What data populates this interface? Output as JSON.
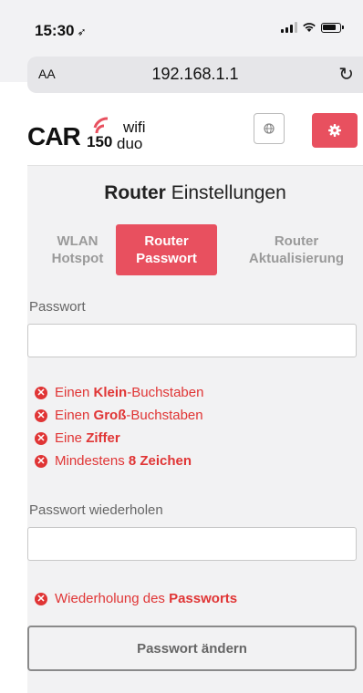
{
  "status_bar": {
    "time": "15:30",
    "location_glyph": "➶"
  },
  "browser": {
    "text_size_label": "AA",
    "url": "192.168.1.1",
    "reload_glyph": "↻"
  },
  "brand": {
    "car": "CAR",
    "model": "150",
    "wifi": "wifi",
    "duo": "duo",
    "accent": "#e8505f"
  },
  "page": {
    "title_bold": "Router",
    "title_rest": " Einstellungen"
  },
  "tabs": [
    {
      "line1": "WLAN",
      "line2": "Hotspot",
      "active": false
    },
    {
      "line1": "Router",
      "line2": "Passwort",
      "active": true
    },
    {
      "line1": "Router",
      "line2": "Aktualisierung",
      "active": false
    }
  ],
  "password": {
    "label": "Passwort",
    "value": ""
  },
  "requirements": [
    {
      "pre": "Einen ",
      "bold": "Klein",
      "post": "-Buchstaben"
    },
    {
      "pre": "Einen ",
      "bold": "Groß",
      "post": "-Buchstaben"
    },
    {
      "pre": "Eine ",
      "bold": "Ziffer",
      "post": ""
    },
    {
      "pre": "Mindestens ",
      "bold": "8 Zeichen",
      "post": ""
    }
  ],
  "repeat": {
    "label": "Passwort wiederholen",
    "value": "",
    "requirement": {
      "pre": "Wiederholung des ",
      "bold": "Passworts",
      "post": ""
    }
  },
  "submit_label": "Passwort ändern",
  "error_color": "#e03535",
  "icons": {
    "error": "times-circle-icon",
    "globe": "globe-icon",
    "gear": "gear-icon"
  }
}
